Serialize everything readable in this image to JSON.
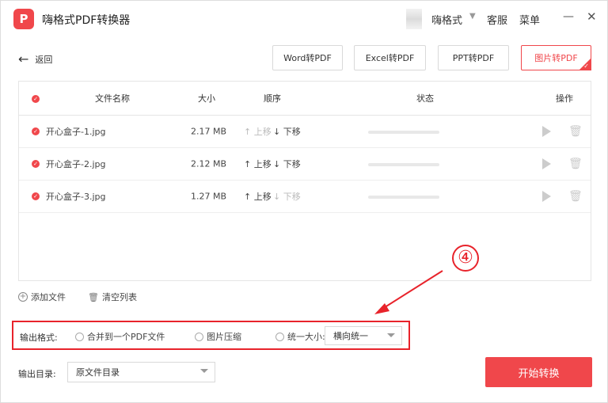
{
  "app": {
    "title": "嗨格式PDF转换器",
    "logo_letter": "P"
  },
  "titlebar": {
    "user": "嗨格式",
    "service": "客服",
    "menu": "菜单",
    "minimize": "—",
    "close": "✕"
  },
  "back_label": "返回",
  "modes": [
    {
      "label": "Word转PDF",
      "active": false
    },
    {
      "label": "Excel转PDF",
      "active": false
    },
    {
      "label": "PPT转PDF",
      "active": false
    },
    {
      "label": "图片转PDF",
      "active": true
    }
  ],
  "table": {
    "headers": {
      "name": "文件名称",
      "size": "大小",
      "order": "顺序",
      "status": "状态",
      "action": "操作"
    },
    "rows": [
      {
        "name": "开心盒子-1.jpg",
        "size": "2.17 MB",
        "up": "上移",
        "down": "下移",
        "up_enabled": false,
        "down_enabled": true
      },
      {
        "name": "开心盒子-2.jpg",
        "size": "2.12 MB",
        "up": "上移",
        "down": "下移",
        "up_enabled": true,
        "down_enabled": true
      },
      {
        "name": "开心盒子-3.jpg",
        "size": "1.27 MB",
        "up": "上移",
        "down": "下移",
        "up_enabled": true,
        "down_enabled": false
      }
    ]
  },
  "add_file": "添加文件",
  "clear_list": "清空列表",
  "output_format": {
    "label": "输出格式:",
    "options": [
      "合并到一个PDF文件",
      "图片压缩",
      "统一大小:"
    ],
    "size_select": "横向统一"
  },
  "output_dir": {
    "label": "输出目录:",
    "value": "原文件目录"
  },
  "start_button": "开始转换",
  "annotation": {
    "number": "④"
  },
  "colors": {
    "accent": "#f0474b",
    "annotation": "#e8232b"
  }
}
